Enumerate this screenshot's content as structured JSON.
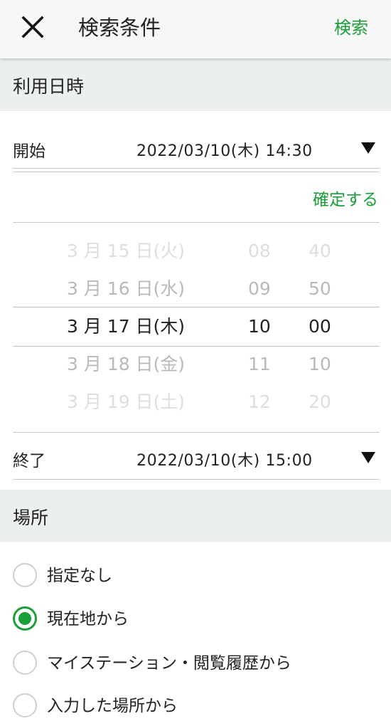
{
  "header": {
    "title": "検索条件",
    "search_label": "検索",
    "close_icon": "close-icon"
  },
  "usage": {
    "section_title": "利用日時",
    "start": {
      "label": "開始",
      "value": "2022/03/10(木) 14:30"
    },
    "confirm_label": "確定する",
    "picker": {
      "rows": [
        {
          "date": "3 月 15 日(火)",
          "hour": "08",
          "minute": "40"
        },
        {
          "date": "3 月 16 日(水)",
          "hour": "09",
          "minute": "50"
        },
        {
          "date": "3 月 17 日(木)",
          "hour": "10",
          "minute": "00"
        },
        {
          "date": "3 月 18 日(金)",
          "hour": "11",
          "minute": "10"
        },
        {
          "date": "3 月 19 日(土)",
          "hour": "12",
          "minute": "20"
        }
      ],
      "selected_index": 2
    },
    "end": {
      "label": "終了",
      "value": "2022/03/10(木) 15:00"
    }
  },
  "place": {
    "section_title": "場所",
    "options": [
      {
        "label": "指定なし",
        "checked": false
      },
      {
        "label": "現在地から",
        "checked": true
      },
      {
        "label": "マイステーション・閲覧履歴から",
        "checked": false
      },
      {
        "label": "入力した場所から",
        "checked": false
      }
    ]
  },
  "colors": {
    "accent": "#1a9e38",
    "section_bg": "#ecf0ed",
    "header_bg": "#f7f7f7"
  }
}
